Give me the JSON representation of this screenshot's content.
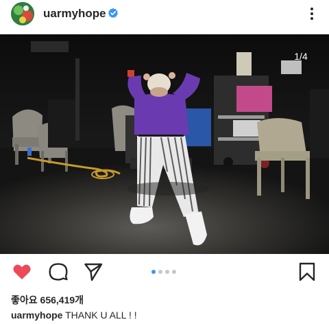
{
  "post": {
    "username": "uarmyhope",
    "verified": true,
    "slide_counter": "1/4",
    "slide_index": 1,
    "slide_total": 4,
    "likes_text": "좋아요 656,419개",
    "caption_user": "uarmyhope",
    "caption_text": " THANK U ALL ! !"
  },
  "icons": {
    "more": "more-vertical-icon",
    "like": "heart-filled-icon",
    "comment": "comment-icon",
    "share": "send-icon",
    "save": "bookmark-icon",
    "verified": "verified-badge-icon"
  },
  "colors": {
    "like": "#ed4956",
    "verified": "#3897f0",
    "active_dot": "#3897f0",
    "inactive_dot": "#c7c7c7",
    "text": "#262626"
  }
}
